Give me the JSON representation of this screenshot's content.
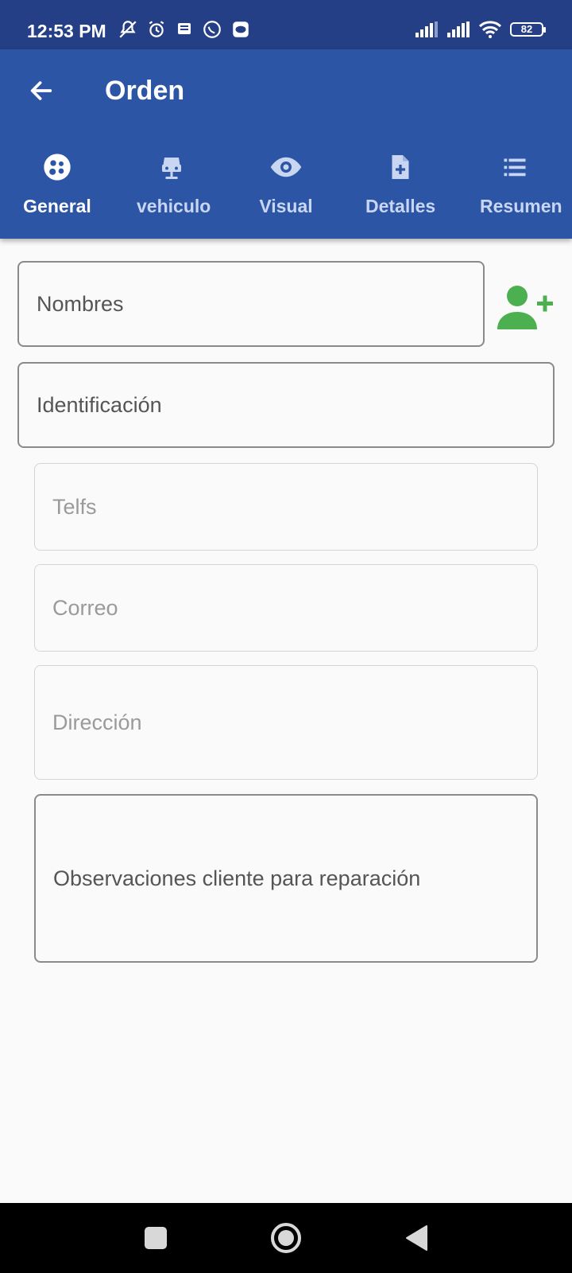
{
  "status_bar": {
    "time": "12:53 PM",
    "battery": "82",
    "left_icons": [
      "mute-icon",
      "alarm-icon",
      "message-icon",
      "whatsapp-icon",
      "chat-icon"
    ],
    "right_icons": [
      "signal-icon",
      "signal-icon",
      "wifi-icon",
      "battery-icon"
    ]
  },
  "app_bar": {
    "title": "Orden",
    "back_icon": "arrow-left-icon"
  },
  "tabs": [
    {
      "label": "General",
      "icon": "group-icon",
      "active": true
    },
    {
      "label": "vehiculo",
      "icon": "car-icon",
      "active": false
    },
    {
      "label": "Visual",
      "icon": "eye-icon",
      "active": false
    },
    {
      "label": "Detalles",
      "icon": "document-add-icon",
      "active": false
    },
    {
      "label": "Resumen",
      "icon": "list-icon",
      "active": false
    }
  ],
  "form": {
    "nombres": "Nombres",
    "identificacion": "Identificación",
    "telfs": "Telfs",
    "correo": "Correo",
    "direccion": "Dirección",
    "observaciones": "Observaciones cliente para reparación"
  },
  "colors": {
    "status_bar": "#243f85",
    "app_bar": "#2d55a6",
    "add_user_icon": "#4caf50",
    "background": "#fafafa"
  },
  "nav_bar": {
    "icons": [
      "recents-square-icon",
      "home-circle-icon",
      "back-triangle-icon"
    ]
  }
}
